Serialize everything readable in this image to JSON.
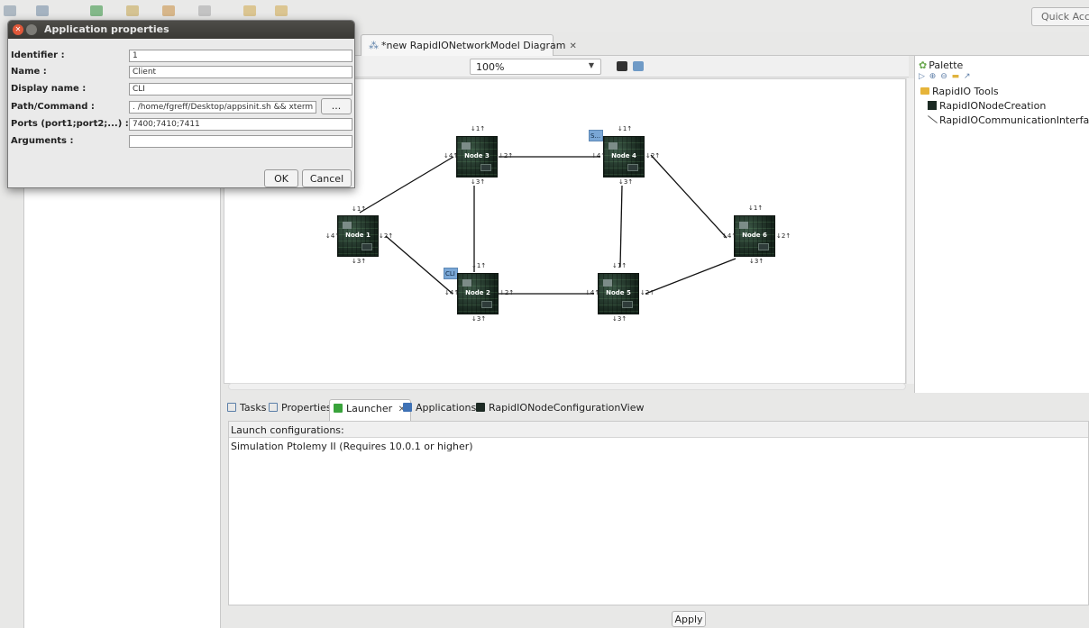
{
  "toolbar": {
    "quick_access": "Quick Access"
  },
  "editor": {
    "tab_title": "*new RapidIONetworkModel Diagram",
    "tab_close": "✕",
    "zoom": "100%"
  },
  "palette": {
    "title": "Palette",
    "group": "RapidIO Tools",
    "items": [
      "RapidIONodeCreation",
      "RapidIOCommunicationInterfaceId"
    ]
  },
  "diagram": {
    "nodes": [
      "Node 1",
      "Node 2",
      "Node 3",
      "Node 4",
      "Node 5",
      "Node 6"
    ],
    "ports": {
      "p1": "↓1↑",
      "p2": "↓2↑",
      "p3": "↓3↑",
      "p4": "↓4↑"
    },
    "badges": {
      "node2": "CLI",
      "node4": "S..."
    }
  },
  "views": {
    "tabs": [
      "Tasks",
      "Properties",
      "Launcher",
      "Applications",
      "RapidIONodeConfigurationView"
    ],
    "launch_header": "Launch configurations:",
    "launch_items": [
      "Simulation Ptolemy II (Requires 10.0.1 or higher)"
    ],
    "apply": "Apply"
  },
  "dialog": {
    "title": "Application properties",
    "labels": {
      "identifier": "Identifier :",
      "name": "Name :",
      "display_name": "Display name :",
      "path": "Path/Command :",
      "ports": "Ports (port1;port2;...) :",
      "arguments": "Arguments :"
    },
    "values": {
      "identifier": "1",
      "name": "Client",
      "display_name": "CLI",
      "path": ". /home/fgreff/Desktop/appsinit.sh && xterm -e",
      "ports": "7400;7410;7411",
      "arguments": ""
    },
    "browse": "...",
    "ok": "OK",
    "cancel": "Cancel"
  }
}
